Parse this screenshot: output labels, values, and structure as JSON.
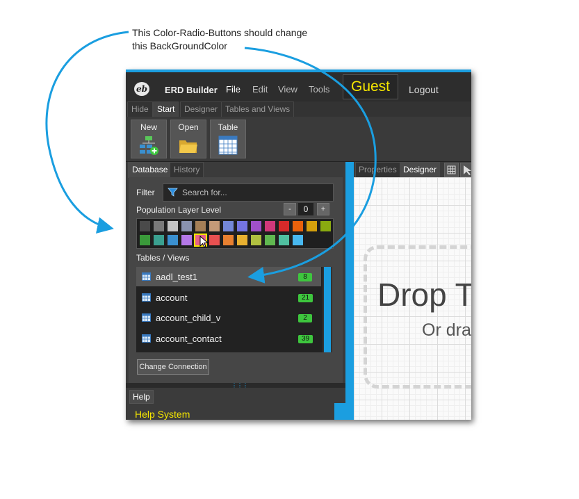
{
  "annotation": {
    "line1": "This Color-Radio-Buttons should change",
    "line2": "this BackGroundColor"
  },
  "menubar": {
    "logo_text": "eb",
    "app_title": "ERD Builder",
    "items": [
      "File",
      "Edit",
      "View",
      "Tools"
    ],
    "user": "Guest",
    "logout": "Logout"
  },
  "tabs": [
    "Hide",
    "Start",
    "Designer",
    "Tables and Views"
  ],
  "active_tab": "Start",
  "ribbon": {
    "buttons": [
      "New",
      "Open",
      "Table"
    ]
  },
  "left_panel": {
    "tabs": [
      "Database",
      "History"
    ],
    "filter_label": "Filter",
    "filter_placeholder": "Search for...",
    "population_label": "Population Layer Level",
    "population_value": "0",
    "stepper_minus": "-",
    "stepper_plus": "+",
    "swatch_colors": [
      [
        "#4a4a4a",
        "#7a7a7a",
        "#c4c4c4",
        "#8a93b0",
        "#a57f57",
        "#c49a78",
        "#7488d8",
        "#7474e0",
        "#a050c8",
        "#d0387a",
        "#d82a2a",
        "#e8620c",
        "#d4a00c",
        "#8aaa10"
      ],
      [
        "#3a9a3a",
        "#3aa090",
        "#3a90d0",
        "#b478e8",
        "#e86088",
        "#e85050",
        "#e88030",
        "#e8b030",
        "#b0c040",
        "#60b850",
        "#50c0a0",
        "#48b8f0"
      ]
    ],
    "selected_swatch": "#e86088",
    "tables_label": "Tables / Views",
    "tables": [
      {
        "name": "aadl_test1",
        "count": "8"
      },
      {
        "name": "account",
        "count": "21"
      },
      {
        "name": "account_child_v",
        "count": "2"
      },
      {
        "name": "account_contact",
        "count": "39"
      }
    ],
    "change_connection": "Change Connection"
  },
  "help": {
    "tab": "Help",
    "title": "Help System"
  },
  "right_panel": {
    "tabs": [
      "Properties",
      "Designer"
    ],
    "drop_title": "Drop T",
    "drop_subtitle": "Or dra"
  },
  "colors": {
    "accent": "#1b9ee0",
    "guest": "#f5e600",
    "badge": "#3ec63e"
  }
}
